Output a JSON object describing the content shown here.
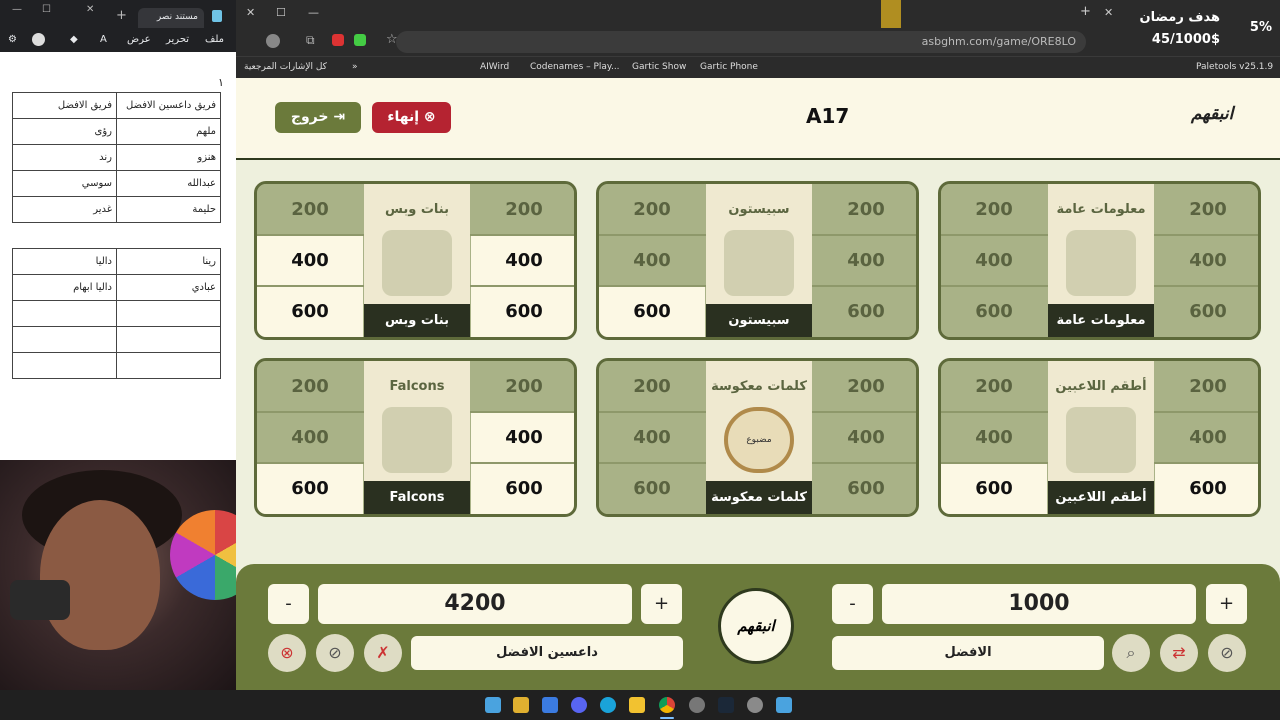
{
  "docs": {
    "tab_title": "مستند نصر",
    "menu": [
      "ملف",
      "تحرير",
      "عرض"
    ],
    "number_mark": "١",
    "table1": [
      [
        "فريق داعسين الافضل",
        "فريق الافضل"
      ],
      [
        "ملهم",
        "رؤى"
      ],
      [
        "هنزو",
        "رند"
      ],
      [
        "عبدالله",
        "سوسي"
      ],
      [
        "حليمة",
        "غدير"
      ]
    ],
    "table2": [
      [
        "رينا",
        "داليا"
      ],
      [
        "عبادي",
        "داليا ابهام"
      ],
      [
        "",
        ""
      ],
      [
        "",
        ""
      ],
      [
        "",
        ""
      ]
    ]
  },
  "overlay": {
    "goal_label": "هدف رمضان",
    "goal_value": "45/1000$",
    "percent": "5%",
    "small_label": "استقم"
  },
  "browser": {
    "url": "asbghm.com/game/ORE8LO",
    "bookmarks_folder": "كل الإشارات المرجعية",
    "bookmarks": [
      "AIWird",
      "Codenames – Play...",
      "Gartic Show",
      "Gartic Phone",
      "Paletools v25.1.9"
    ]
  },
  "game": {
    "logo": "انبقهم",
    "room_code": "A17",
    "end_label": "إنهاء",
    "exit_label": "خروج",
    "categories": [
      {
        "name": "معلومات عامة",
        "left": [
          "200",
          "400",
          "600"
        ],
        "right": [
          "200",
          "400",
          "600"
        ],
        "left_state": [
          "used",
          "used",
          "used"
        ],
        "right_state": [
          "used",
          "used",
          "used"
        ]
      },
      {
        "name": "سبيستون",
        "left": [
          "200",
          "400",
          "600"
        ],
        "right": [
          "200",
          "400",
          "600"
        ],
        "left_state": [
          "used",
          "used",
          "active"
        ],
        "right_state": [
          "used",
          "used",
          "used"
        ]
      },
      {
        "name": "بنات وبس",
        "left": [
          "200",
          "400",
          "600"
        ],
        "right": [
          "200",
          "400",
          "600"
        ],
        "left_state": [
          "used",
          "active",
          "active"
        ],
        "right_state": [
          "used",
          "active",
          "active"
        ]
      },
      {
        "name": "أطقم اللاعبين",
        "left": [
          "200",
          "400",
          "600"
        ],
        "right": [
          "200",
          "400",
          "600"
        ],
        "left_state": [
          "used",
          "used",
          "active"
        ],
        "right_state": [
          "used",
          "used",
          "active"
        ]
      },
      {
        "name": "كلمات معكوسة",
        "left": [
          "200",
          "400",
          "600"
        ],
        "right": [
          "200",
          "400",
          "600"
        ],
        "left_state": [
          "used",
          "used",
          "used"
        ],
        "right_state": [
          "used",
          "used",
          "used"
        ]
      },
      {
        "name": "Falcons",
        "left": [
          "200",
          "400",
          "600"
        ],
        "right": [
          "200",
          "400",
          "600"
        ],
        "left_state": [
          "used",
          "used",
          "active"
        ],
        "right_state": [
          "used",
          "active",
          "active"
        ]
      }
    ],
    "mirror_label": "مضبوع",
    "team_right": {
      "name": "الافضل",
      "score": "1000"
    },
    "team_left": {
      "name": "داعسين الافضل",
      "score": "4200"
    },
    "plus": "+",
    "minus": "-"
  },
  "colors": {
    "accent": "#6b7a3b",
    "danger": "#b52331",
    "cream": "#fbf8e6"
  }
}
